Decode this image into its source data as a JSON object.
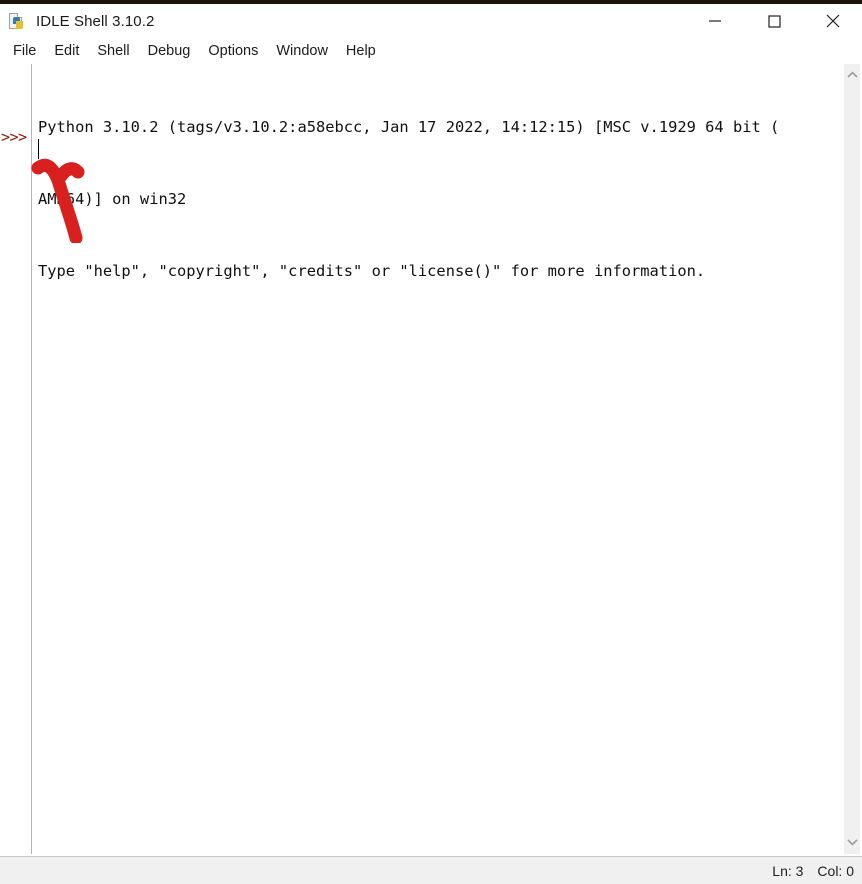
{
  "window": {
    "title": "IDLE Shell 3.10.2",
    "icon": "python-file-icon",
    "controls": {
      "minimize": "minimize-icon",
      "maximize": "maximize-icon",
      "close": "close-icon"
    }
  },
  "menubar": {
    "items": [
      {
        "label": "File"
      },
      {
        "label": "Edit"
      },
      {
        "label": "Shell"
      },
      {
        "label": "Debug"
      },
      {
        "label": "Options"
      },
      {
        "label": "Window"
      },
      {
        "label": "Help"
      }
    ]
  },
  "shell": {
    "lines": [
      "Python 3.10.2 (tags/v3.10.2:a58ebcc, Jan 17 2022, 14:12:15) [MSC v.1929 64 bit (",
      "AMD64)] on win32",
      "Type \"help\", \"copyright\", \"credits\" or \"license()\" for more information."
    ],
    "prompt": ">>>",
    "prompt_color": "#8b1a0e",
    "input_value": "",
    "scrollbar": {
      "up_arrow": "chevron-up-icon",
      "down_arrow": "chevron-down-icon"
    }
  },
  "statusbar": {
    "line_label": "Ln: 3",
    "col_label": "Col: 0"
  },
  "annotation": {
    "type": "arrow",
    "color": "#d8211f",
    "points_to": "shell-prompt-caret"
  }
}
